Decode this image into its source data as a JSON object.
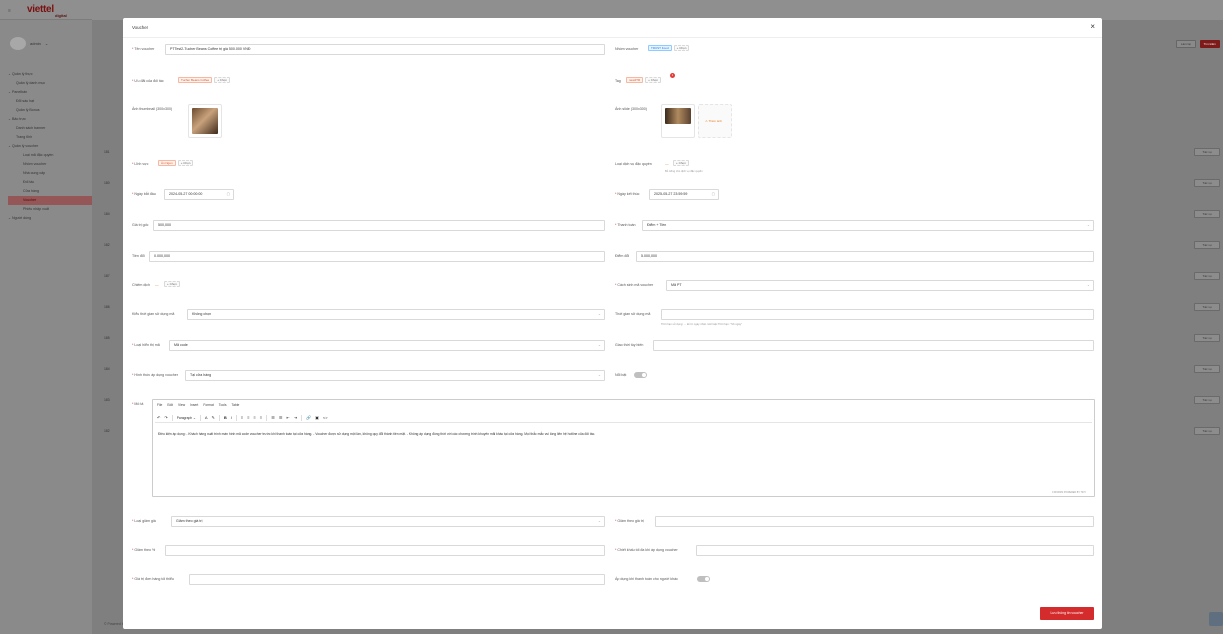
{
  "brand": {
    "name": "viettel",
    "sub": "digital"
  },
  "user": {
    "name": "admin"
  },
  "sidebar": {
    "items": [
      {
        "label": "Quản lý thực",
        "level": 1
      },
      {
        "label": "Quản lý danh mục",
        "level": 2
      },
      {
        "label": "Panelbán",
        "level": 1
      },
      {
        "label": "Đổi sàu hạt",
        "level": 2
      },
      {
        "label": "Quản lý Bonus",
        "level": 2
      },
      {
        "label": "Bảo trực",
        "level": 1
      },
      {
        "label": "Danh sách banner",
        "level": 2
      },
      {
        "label": "Trang tĩnh",
        "level": 2
      },
      {
        "label": "Quản lý voucher",
        "level": 1
      },
      {
        "label": "Loại mã đặc quyền",
        "level": 3
      },
      {
        "label": "Nhóm voucher",
        "level": 3
      },
      {
        "label": "Nhà cung cấp",
        "level": 3
      },
      {
        "label": "Đối tác",
        "level": 3
      },
      {
        "label": "Cửa hàng",
        "level": 3
      },
      {
        "label": "Voucher",
        "level": 3,
        "active": true
      },
      {
        "label": "Phiếu nhập xuất",
        "level": 3
      },
      {
        "label": "Người dùng",
        "level": 1
      }
    ]
  },
  "background": {
    "buttons": [
      "Làm lại",
      "Tìm kiếm"
    ],
    "row_action": "Tác vụ",
    "row_ids": [
      "181",
      "180",
      "184",
      "182",
      "187",
      "186",
      "185",
      "184",
      "183",
      "182"
    ],
    "footer": "© Powered by Viettel"
  },
  "modal": {
    "title": "Voucher",
    "save_label": "Lưu thông tin voucher",
    "fields": {
      "name": {
        "label": "Tên voucher",
        "value": "PTTest2-Tucher Beans Coffee trị giá 500.000 VNĐ"
      },
      "group": {
        "label": "Nhóm voucher",
        "tags": [
          "TRUST Food",
          "+ Chọn"
        ]
      },
      "partner_discount": {
        "label": "Ưu đãi của đối tác",
        "tags": [
          "Tucher Beans Coffee",
          "+ Chọn"
        ]
      },
      "tag": {
        "label": "Tag",
        "tags": [
          "new2TR",
          "+ Chọn"
        ],
        "badge": "1"
      },
      "thumbnail": {
        "label": "Ảnh thumbnail (300x300)"
      },
      "slide": {
        "label": "Ảnh slide (300x300)",
        "add": "Thêm ảnh"
      },
      "category": {
        "label": "Lĩnh vực",
        "tags": [
          "Ăn Ngon",
          "+ Chọn"
        ]
      },
      "privilege": {
        "label": "Loại dịch vụ đặc quyền",
        "tag": "+ Chọn",
        "hint": "Bỏ trống cho dịch vụ đặc quyền"
      },
      "start_date": {
        "label": "Ngày bắt đầu",
        "value": "2024-05-27 00:00:00"
      },
      "end_date": {
        "label": "Ngày kết thúc",
        "value": "2025-05-27 23:59:59"
      },
      "value": {
        "label": "Giá trị gốc",
        "value": "500,000"
      },
      "payment": {
        "label": "Thanh toán",
        "value": "Điểm + Tiền"
      },
      "money": {
        "label": "Tiền đổi",
        "value": "0.000,000"
      },
      "points": {
        "label": "Điểm đổi",
        "value": "5.000,000"
      },
      "apply_points": {
        "label": "Chiếm dịch",
        "tag": "+ Chọn"
      },
      "code_type": {
        "label": "Cách sinh mã voucher",
        "value": "Mã PT"
      },
      "use_time_type": {
        "label": "Kiểu thời gian sử dụng mã",
        "value": "Không chọn"
      },
      "use_time": {
        "label": "Thời gian sử dụng mã",
        "value": "",
        "hint": "Thời hạn sử dụng: ... kể từ ngày nhận mã hoặc Thời hạn: \"Số ngày\""
      },
      "display_type": {
        "label": "Loại hiển thị mã",
        "value": "Mã code"
      },
      "barcode_display": {
        "label": "Giao thời tùy biến",
        "value": ""
      },
      "apply_mode": {
        "label": "Hình thức áp dụng voucher",
        "value": "Tại cửa hàng"
      },
      "hot": {
        "label": "Nổi bật"
      },
      "discount_type": {
        "label": "Loại giảm giá",
        "value": "Giảm theo giá trị"
      },
      "discount_value": {
        "label": "Giảm theo giá trị",
        "value": ""
      },
      "discount_percent": {
        "label": "Giảm theo %",
        "value": ""
      },
      "min_bill": {
        "label": "Chiết khấu tối đa khi áp dụng voucher",
        "value": ""
      },
      "min_spend": {
        "label": "Giá trị đơn hàng tối thiểu",
        "value": ""
      },
      "apply_member": {
        "label": "Áp dụng khi thanh toán cho người khác"
      }
    },
    "editor": {
      "label": "Mô tả",
      "menu": [
        "File",
        "Edit",
        "View",
        "Insert",
        "Format",
        "Tools",
        "Table"
      ],
      "block": "Paragraph",
      "content": "Điều kiện áp dụng: - Khách hàng xuất trình màn hình mã code voucher trước khi thanh toán tại cửa hàng. - Voucher được sử dụng một lần, không quy đổi thành tiền mặt. - Không áp dụng đồng thời với các chương trình khuyến mãi khác tại cửa hàng. Mọi thắc mắc vui lòng liên hệ hotline của đối tác.",
      "status": "0 WORDS   POWERED BY TINY"
    }
  }
}
